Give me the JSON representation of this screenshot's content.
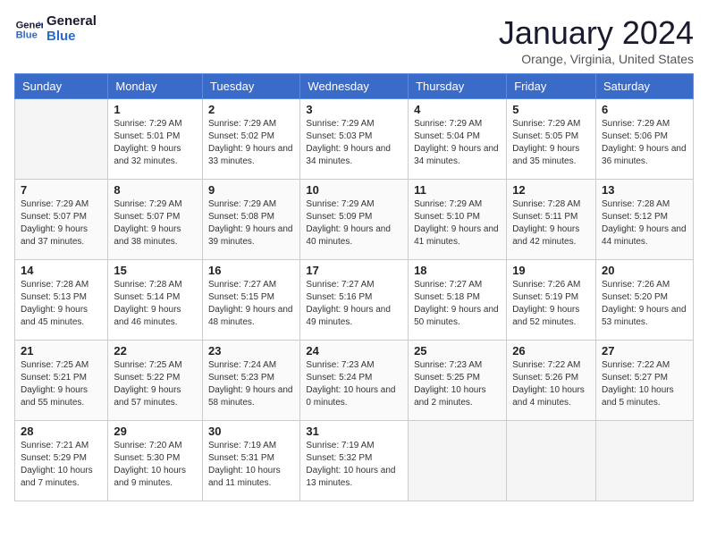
{
  "logo": {
    "line1": "General",
    "line2": "Blue"
  },
  "title": "January 2024",
  "subtitle": "Orange, Virginia, United States",
  "days_header": [
    "Sunday",
    "Monday",
    "Tuesday",
    "Wednesday",
    "Thursday",
    "Friday",
    "Saturday"
  ],
  "weeks": [
    [
      {
        "num": "",
        "sunrise": "",
        "sunset": "",
        "daylight": ""
      },
      {
        "num": "1",
        "sunrise": "Sunrise: 7:29 AM",
        "sunset": "Sunset: 5:01 PM",
        "daylight": "Daylight: 9 hours and 32 minutes."
      },
      {
        "num": "2",
        "sunrise": "Sunrise: 7:29 AM",
        "sunset": "Sunset: 5:02 PM",
        "daylight": "Daylight: 9 hours and 33 minutes."
      },
      {
        "num": "3",
        "sunrise": "Sunrise: 7:29 AM",
        "sunset": "Sunset: 5:03 PM",
        "daylight": "Daylight: 9 hours and 34 minutes."
      },
      {
        "num": "4",
        "sunrise": "Sunrise: 7:29 AM",
        "sunset": "Sunset: 5:04 PM",
        "daylight": "Daylight: 9 hours and 34 minutes."
      },
      {
        "num": "5",
        "sunrise": "Sunrise: 7:29 AM",
        "sunset": "Sunset: 5:05 PM",
        "daylight": "Daylight: 9 hours and 35 minutes."
      },
      {
        "num": "6",
        "sunrise": "Sunrise: 7:29 AM",
        "sunset": "Sunset: 5:06 PM",
        "daylight": "Daylight: 9 hours and 36 minutes."
      }
    ],
    [
      {
        "num": "7",
        "sunrise": "Sunrise: 7:29 AM",
        "sunset": "Sunset: 5:07 PM",
        "daylight": "Daylight: 9 hours and 37 minutes."
      },
      {
        "num": "8",
        "sunrise": "Sunrise: 7:29 AM",
        "sunset": "Sunset: 5:07 PM",
        "daylight": "Daylight: 9 hours and 38 minutes."
      },
      {
        "num": "9",
        "sunrise": "Sunrise: 7:29 AM",
        "sunset": "Sunset: 5:08 PM",
        "daylight": "Daylight: 9 hours and 39 minutes."
      },
      {
        "num": "10",
        "sunrise": "Sunrise: 7:29 AM",
        "sunset": "Sunset: 5:09 PM",
        "daylight": "Daylight: 9 hours and 40 minutes."
      },
      {
        "num": "11",
        "sunrise": "Sunrise: 7:29 AM",
        "sunset": "Sunset: 5:10 PM",
        "daylight": "Daylight: 9 hours and 41 minutes."
      },
      {
        "num": "12",
        "sunrise": "Sunrise: 7:28 AM",
        "sunset": "Sunset: 5:11 PM",
        "daylight": "Daylight: 9 hours and 42 minutes."
      },
      {
        "num": "13",
        "sunrise": "Sunrise: 7:28 AM",
        "sunset": "Sunset: 5:12 PM",
        "daylight": "Daylight: 9 hours and 44 minutes."
      }
    ],
    [
      {
        "num": "14",
        "sunrise": "Sunrise: 7:28 AM",
        "sunset": "Sunset: 5:13 PM",
        "daylight": "Daylight: 9 hours and 45 minutes."
      },
      {
        "num": "15",
        "sunrise": "Sunrise: 7:28 AM",
        "sunset": "Sunset: 5:14 PM",
        "daylight": "Daylight: 9 hours and 46 minutes."
      },
      {
        "num": "16",
        "sunrise": "Sunrise: 7:27 AM",
        "sunset": "Sunset: 5:15 PM",
        "daylight": "Daylight: 9 hours and 48 minutes."
      },
      {
        "num": "17",
        "sunrise": "Sunrise: 7:27 AM",
        "sunset": "Sunset: 5:16 PM",
        "daylight": "Daylight: 9 hours and 49 minutes."
      },
      {
        "num": "18",
        "sunrise": "Sunrise: 7:27 AM",
        "sunset": "Sunset: 5:18 PM",
        "daylight": "Daylight: 9 hours and 50 minutes."
      },
      {
        "num": "19",
        "sunrise": "Sunrise: 7:26 AM",
        "sunset": "Sunset: 5:19 PM",
        "daylight": "Daylight: 9 hours and 52 minutes."
      },
      {
        "num": "20",
        "sunrise": "Sunrise: 7:26 AM",
        "sunset": "Sunset: 5:20 PM",
        "daylight": "Daylight: 9 hours and 53 minutes."
      }
    ],
    [
      {
        "num": "21",
        "sunrise": "Sunrise: 7:25 AM",
        "sunset": "Sunset: 5:21 PM",
        "daylight": "Daylight: 9 hours and 55 minutes."
      },
      {
        "num": "22",
        "sunrise": "Sunrise: 7:25 AM",
        "sunset": "Sunset: 5:22 PM",
        "daylight": "Daylight: 9 hours and 57 minutes."
      },
      {
        "num": "23",
        "sunrise": "Sunrise: 7:24 AM",
        "sunset": "Sunset: 5:23 PM",
        "daylight": "Daylight: 9 hours and 58 minutes."
      },
      {
        "num": "24",
        "sunrise": "Sunrise: 7:23 AM",
        "sunset": "Sunset: 5:24 PM",
        "daylight": "Daylight: 10 hours and 0 minutes."
      },
      {
        "num": "25",
        "sunrise": "Sunrise: 7:23 AM",
        "sunset": "Sunset: 5:25 PM",
        "daylight": "Daylight: 10 hours and 2 minutes."
      },
      {
        "num": "26",
        "sunrise": "Sunrise: 7:22 AM",
        "sunset": "Sunset: 5:26 PM",
        "daylight": "Daylight: 10 hours and 4 minutes."
      },
      {
        "num": "27",
        "sunrise": "Sunrise: 7:22 AM",
        "sunset": "Sunset: 5:27 PM",
        "daylight": "Daylight: 10 hours and 5 minutes."
      }
    ],
    [
      {
        "num": "28",
        "sunrise": "Sunrise: 7:21 AM",
        "sunset": "Sunset: 5:29 PM",
        "daylight": "Daylight: 10 hours and 7 minutes."
      },
      {
        "num": "29",
        "sunrise": "Sunrise: 7:20 AM",
        "sunset": "Sunset: 5:30 PM",
        "daylight": "Daylight: 10 hours and 9 minutes."
      },
      {
        "num": "30",
        "sunrise": "Sunrise: 7:19 AM",
        "sunset": "Sunset: 5:31 PM",
        "daylight": "Daylight: 10 hours and 11 minutes."
      },
      {
        "num": "31",
        "sunrise": "Sunrise: 7:19 AM",
        "sunset": "Sunset: 5:32 PM",
        "daylight": "Daylight: 10 hours and 13 minutes."
      },
      {
        "num": "",
        "sunrise": "",
        "sunset": "",
        "daylight": ""
      },
      {
        "num": "",
        "sunrise": "",
        "sunset": "",
        "daylight": ""
      },
      {
        "num": "",
        "sunrise": "",
        "sunset": "",
        "daylight": ""
      }
    ]
  ]
}
